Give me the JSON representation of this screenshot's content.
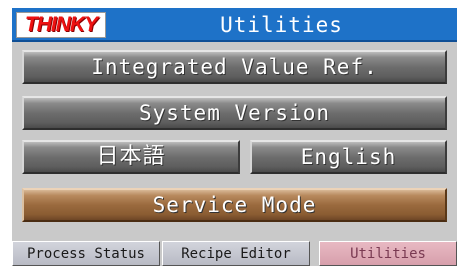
{
  "title_bar": {
    "logo_text": "THINKY",
    "title": "Utilities"
  },
  "buttons": {
    "integrated_value": "Integrated Value Ref.",
    "system_version": "System Version",
    "japanese": "日本語",
    "english": "English",
    "service_mode": "Service Mode"
  },
  "tabs": [
    {
      "label": "Process Status",
      "active": false
    },
    {
      "label": "Recipe Editor",
      "active": false
    },
    {
      "label": "Utilities",
      "active": true
    }
  ],
  "colors": {
    "title_bar": "#1e72c8",
    "button_gray": "#6d6d6d",
    "service_button": "#9a6a3e",
    "active_tab": "#d79fac"
  }
}
